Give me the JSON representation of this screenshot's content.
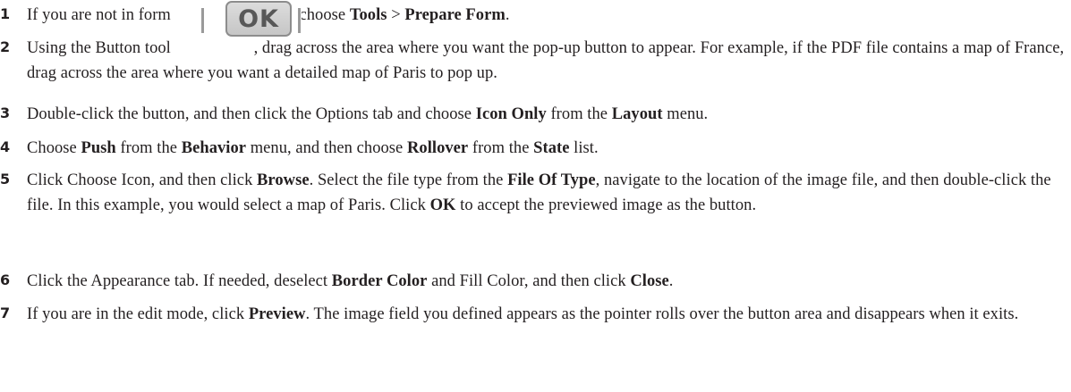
{
  "ok_button_label": "OK",
  "steps": [
    {
      "number": "1",
      "parts": [
        "If you are not in form ",
        "de, choose ",
        "Tools",
        " > ",
        "Prepare Form",
        "."
      ]
    },
    {
      "number": "2",
      "parts": [
        "Using the Button tool ",
        ", drag across the area where you want the pop-up button to appear. For example, if the PDF file contains a map of France, drag across the area where you want a detailed map of Paris to pop up."
      ]
    },
    {
      "number": "3",
      "parts": [
        "Double-click the button, and then click the Options tab and choose ",
        "Icon Only",
        " from the ",
        "Layout",
        " menu."
      ]
    },
    {
      "number": "4",
      "parts": [
        "Choose ",
        "Push",
        " from the ",
        "Behavior",
        " menu, and then choose ",
        "Rollover",
        " from the ",
        "State",
        " list."
      ]
    },
    {
      "number": "5",
      "parts": [
        "Click Choose Icon, and then click ",
        "Browse",
        ". Select the file type from the ",
        "File Of Type",
        ", navigate to the location of the image file, and then double-click the file. In this example, you would select a map of Paris. Click ",
        "OK",
        " to accept the previewed image as the button."
      ]
    },
    {
      "number": "6",
      "parts": [
        "Click the Appearance tab. If needed, deselect ",
        "Border Color",
        " and Fill Color, and then click ",
        "Close",
        "."
      ]
    },
    {
      "number": "7",
      "parts": [
        "If you are in the edit mode, click ",
        "Preview",
        ". The image field you defined appears as the pointer rolls over the button area and disappears when it exits."
      ]
    }
  ]
}
